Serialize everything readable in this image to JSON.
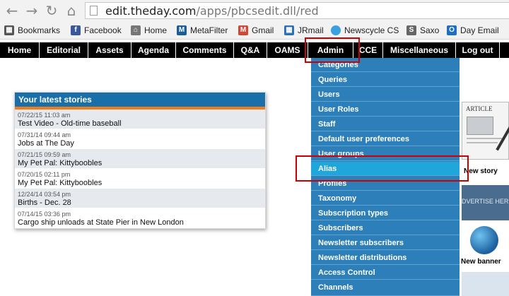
{
  "browser": {
    "url_host": "edit.theday.com",
    "url_path": "/apps/pbcsedit.dll/red",
    "nav_icons": [
      "back-arrow-icon",
      "forward-arrow-icon",
      "reload-icon",
      "home-icon",
      "page-icon"
    ],
    "bookmarks": [
      {
        "label": "Bookmarks",
        "icon": "apps-grid-icon",
        "color": "#555555"
      },
      {
        "label": "Facebook",
        "icon": "facebook-icon",
        "color": "#3b5998"
      },
      {
        "label": "Home",
        "icon": "home-icon",
        "color": "#777777"
      },
      {
        "label": "MetaFilter",
        "icon": "metafilter-icon",
        "color": "#1a5d9a"
      },
      {
        "label": "Gmail",
        "icon": "gmail-icon",
        "color": "#d14836"
      },
      {
        "label": "JRmail",
        "icon": "grid-icon",
        "color": "#2f6fb4"
      },
      {
        "label": "Newscycle CS",
        "icon": "cloud-icon",
        "color": "#3aa0e0"
      },
      {
        "label": "Saxo",
        "icon": "saxo-icon",
        "color": "#666666"
      },
      {
        "label": "Day Email",
        "icon": "outlook-icon",
        "color": "#1e6fc2"
      }
    ]
  },
  "nav": {
    "items": [
      "Home",
      "Editorial",
      "Assets",
      "Agenda",
      "Comments",
      "Q&A",
      "OAMS",
      "Admin",
      "CCE",
      "Miscellaneous",
      "Log out"
    ]
  },
  "admin_menu": {
    "items": [
      "Categories",
      "Queries",
      "Users",
      "User Roles",
      "Staff",
      "Default user preferences",
      "User groups",
      "Alias",
      "Profiles",
      "Taxonomy",
      "Subscription types",
      "Subscribers",
      "Newsletter subscribers",
      "Newsletter distributions",
      "Access Control",
      "Channels"
    ],
    "active": "Alias"
  },
  "stories": {
    "title": "Your latest stories",
    "items": [
      {
        "date": "07/22/15 11:03 am",
        "title": "Test Video - Old-time baseball"
      },
      {
        "date": "07/31/14 09:44 am",
        "title": "Jobs at The Day"
      },
      {
        "date": "07/21/15 09:59 am",
        "title": "My Pet Pal: Kittyboobles"
      },
      {
        "date": "07/20/15 02:11 pm",
        "title": "My Pet Pal: Kittyboobles"
      },
      {
        "date": "12/24/14 03:54 pm",
        "title": "Births - Dec. 28"
      },
      {
        "date": "07/14/15 03:36 pm",
        "title": "Cargo ship unloads at State Pier in New London"
      }
    ]
  },
  "side": {
    "article_label": "ARTICLE",
    "new_story": "New story",
    "advertise": "DVERTISE HER",
    "new_banner": "New banner"
  },
  "colors": {
    "nav_bg": "#000000",
    "menu_bg": "#2c7fb8",
    "menu_active": "#1fa7dc",
    "stories_header": "#1a6fa8",
    "stories_accent": "#f07c1a",
    "highlight": "#cc0000"
  }
}
